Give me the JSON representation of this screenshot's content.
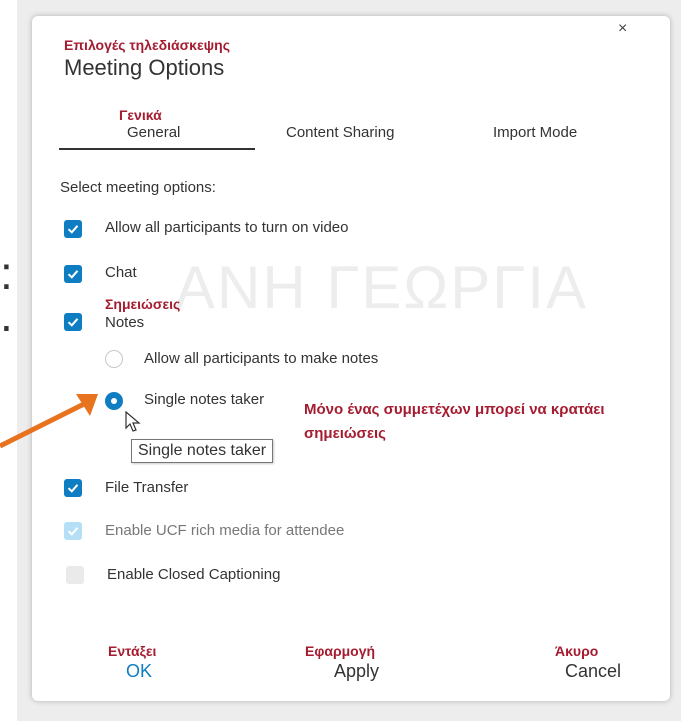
{
  "background": {
    "left_text_1": ":",
    "left_text_2": ".",
    "watermark": "ΑΝΗ ΓΕΩΡΓΙΑ"
  },
  "dialog": {
    "title_greek": "Επιλογές τηλεδιάσκεψης",
    "title": "Meeting Options",
    "close_label": "×",
    "tabs": [
      {
        "label": "General",
        "greek": "Γενικά",
        "active": true
      },
      {
        "label": "Content Sharing",
        "active": false
      },
      {
        "label": "Import Mode",
        "active": false
      }
    ],
    "section_label": "Select meeting options:",
    "options": {
      "video": {
        "label": "Allow all participants to turn on video",
        "checked": true
      },
      "chat": {
        "label": "Chat",
        "checked": true
      },
      "notes": {
        "label": "Notes",
        "greek": "Σημειώσεις",
        "checked": true
      },
      "notes_all": {
        "label": "Allow all participants to make notes",
        "selected": false
      },
      "notes_single": {
        "label": "Single notes taker",
        "selected": true
      },
      "file_transfer": {
        "label": "File Transfer",
        "checked": true
      },
      "ucf": {
        "label": "Enable UCF rich media for attendee",
        "checked": true,
        "disabled": true
      },
      "captioning": {
        "label": "Enable Closed Captioning",
        "checked": false,
        "disabled": true
      }
    },
    "callout_greek": "Μόνο ένας συμμετέχων μπορεί να κρατάει σημειώσεις",
    "tooltip": "Single notes taker",
    "buttons": {
      "ok": {
        "label": "OK",
        "greek": "Εντάξει"
      },
      "apply": {
        "label": "Apply",
        "greek": "Εφαρμογή"
      },
      "cancel": {
        "label": "Cancel",
        "greek": "Άκυρο"
      }
    }
  },
  "colors": {
    "accent": "#0f7dc2",
    "annotation": "#a51c30",
    "arrow": "#e8731e"
  }
}
